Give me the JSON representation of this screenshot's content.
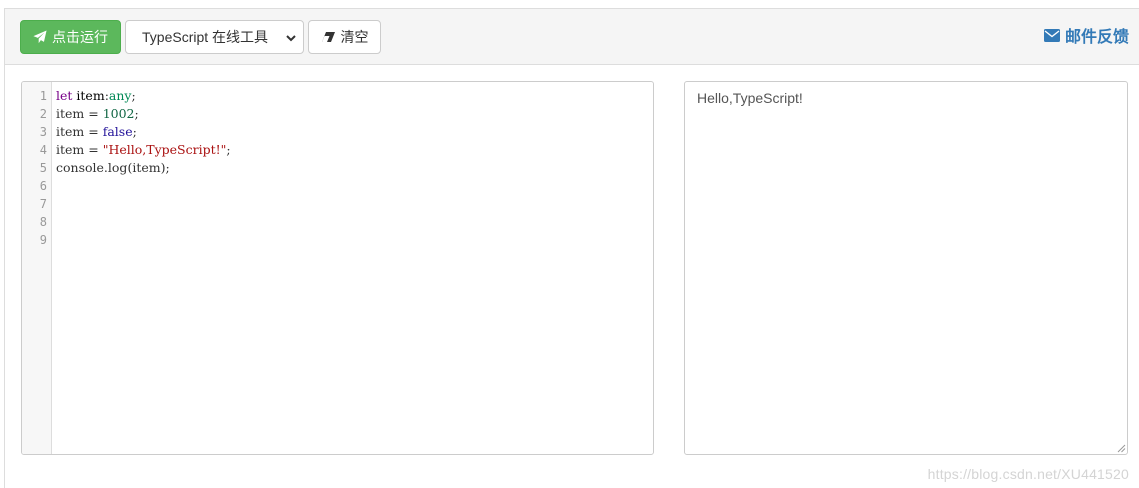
{
  "toolbar": {
    "run_label": "点击运行",
    "run_icon": "paper-plane-icon",
    "language_selected": "TypeScript 在线工具",
    "clear_label": "清空",
    "clear_icon": "eraser-icon",
    "feedback_label": "邮件反馈",
    "feedback_icon": "envelope-icon"
  },
  "editor": {
    "line_numbers": [
      "1",
      "2",
      "3",
      "4",
      "5",
      "6",
      "7",
      "8",
      "9"
    ]
  },
  "output": {
    "text": "Hello,TypeScript!"
  },
  "watermark": "https://blog.csdn.net/XU441520",
  "colors": {
    "run_button": "#5cb85c",
    "link": "#337ab7",
    "keyword": "#770088",
    "string": "#aa1111",
    "number": "#116644"
  }
}
